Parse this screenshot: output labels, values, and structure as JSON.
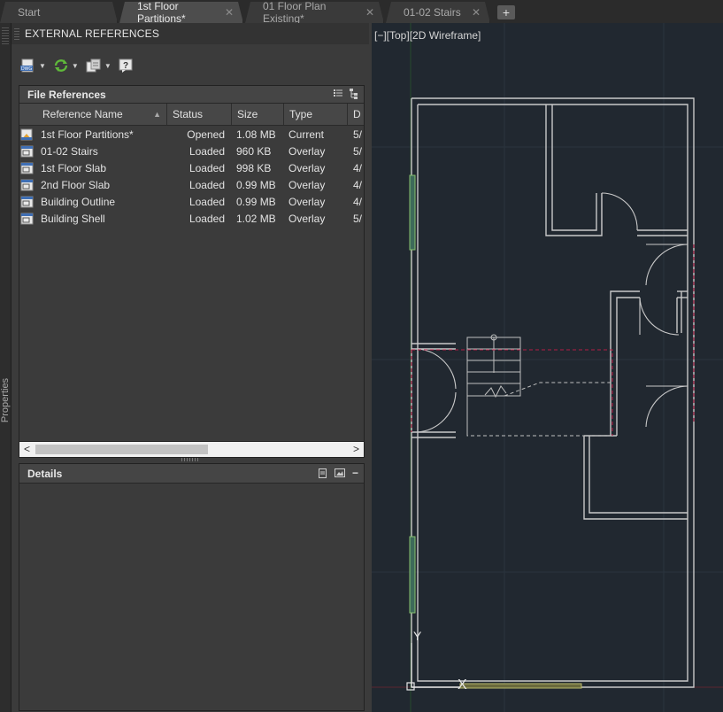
{
  "tabs": [
    {
      "label": "Start",
      "active": false,
      "closable": false
    },
    {
      "label": "1st Floor Partitions*",
      "active": true,
      "closable": true
    },
    {
      "label": "01 Floor Plan Existing*",
      "active": false,
      "closable": true
    },
    {
      "label": "01-02 Stairs",
      "active": false,
      "closable": true
    }
  ],
  "tab_add_label": "+",
  "tab_close_glyph": "✕",
  "left_strip_label": "Properties",
  "palette": {
    "title": "EXTERNAL REFERENCES",
    "toolbar": [
      {
        "icon": "attach-dwg-icon",
        "has_dropdown": true
      },
      {
        "icon": "refresh-icon",
        "has_dropdown": true
      },
      {
        "icon": "change-path-icon",
        "has_dropdown": true
      },
      {
        "icon": "help-icon",
        "has_dropdown": false
      }
    ],
    "file_references": {
      "title": "File References",
      "columns": [
        "Reference Name",
        "Status",
        "Size",
        "Type",
        "D"
      ],
      "rows": [
        {
          "icon": "current-drawing-icon",
          "name": "1st Floor Partitions*",
          "status": "Opened",
          "size": "1.08 MB",
          "type": "Current",
          "date": "5/"
        },
        {
          "icon": "dwg-reference-icon",
          "name": "01-02 Stairs",
          "status": "Loaded",
          "size": "960 KB",
          "type": "Overlay",
          "date": "5/"
        },
        {
          "icon": "dwg-reference-icon",
          "name": "1st Floor Slab",
          "status": "Loaded",
          "size": "998 KB",
          "type": "Overlay",
          "date": "4/"
        },
        {
          "icon": "dwg-reference-icon",
          "name": "2nd Floor Slab",
          "status": "Loaded",
          "size": "0.99 MB",
          "type": "Overlay",
          "date": "4/"
        },
        {
          "icon": "dwg-reference-icon",
          "name": "Building Outline",
          "status": "Loaded",
          "size": "0.99 MB",
          "type": "Overlay",
          "date": "4/"
        },
        {
          "icon": "dwg-reference-icon",
          "name": "Building Shell",
          "status": "Loaded",
          "size": "1.02 MB",
          "type": "Overlay",
          "date": "5/"
        }
      ],
      "scroll_left": "<",
      "scroll_right": ">"
    },
    "details": {
      "title": "Details",
      "collapse": "−"
    }
  },
  "viewport": {
    "label": "[−][Top][2D Wireframe]",
    "ucs_y": "Y",
    "ucs_x": "X",
    "colors": {
      "background": "#212830",
      "wall": "#c8c8c8",
      "glazing": "#8fbf6f",
      "xref_highlight": "#c01f4a",
      "grid": "#2c3540"
    }
  }
}
